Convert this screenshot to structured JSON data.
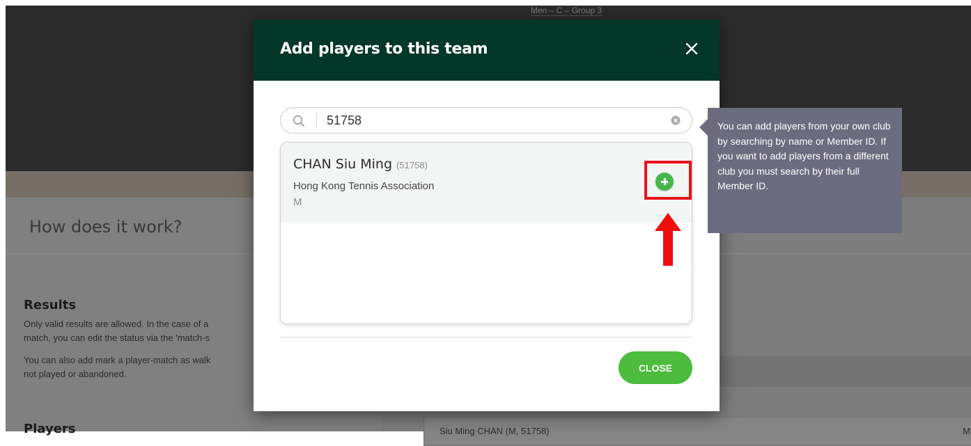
{
  "background": {
    "group_label": "Men – C – Group 3",
    "how_title": "How does it work?",
    "results_title": "Results",
    "results_line1": "Only valid results are allowed. In the case of a",
    "results_line2": "match, you can edit the status via the 'match-s",
    "results_line3": "You can also add mark a player-match as walk",
    "results_line4": "not played or abandoned.",
    "players_title": "Players",
    "card_text": "Siu Ming CHAN (M, 51758)",
    "card_right": "M"
  },
  "modal": {
    "title": "Add players to this team",
    "search": {
      "value": "51758",
      "placeholder": ""
    },
    "results": [
      {
        "name": "CHAN Siu Ming",
        "id": "(51758)",
        "club": "Hong Kong Tennis Association",
        "gender": "M"
      }
    ],
    "close_label": "CLOSE"
  },
  "tooltip": {
    "text": "You can add players from your own club by searching by name or Member ID. If you want to add players from a different club you must search by their full Member ID."
  },
  "colors": {
    "modal_header": "#033728",
    "accent_green": "#45b649",
    "highlight_red": "#e8111a",
    "tooltip_bg": "#6c6c7f"
  },
  "icons": [
    "search-icon",
    "clear-icon",
    "close-icon",
    "plus-icon",
    "arrow-up-icon"
  ]
}
